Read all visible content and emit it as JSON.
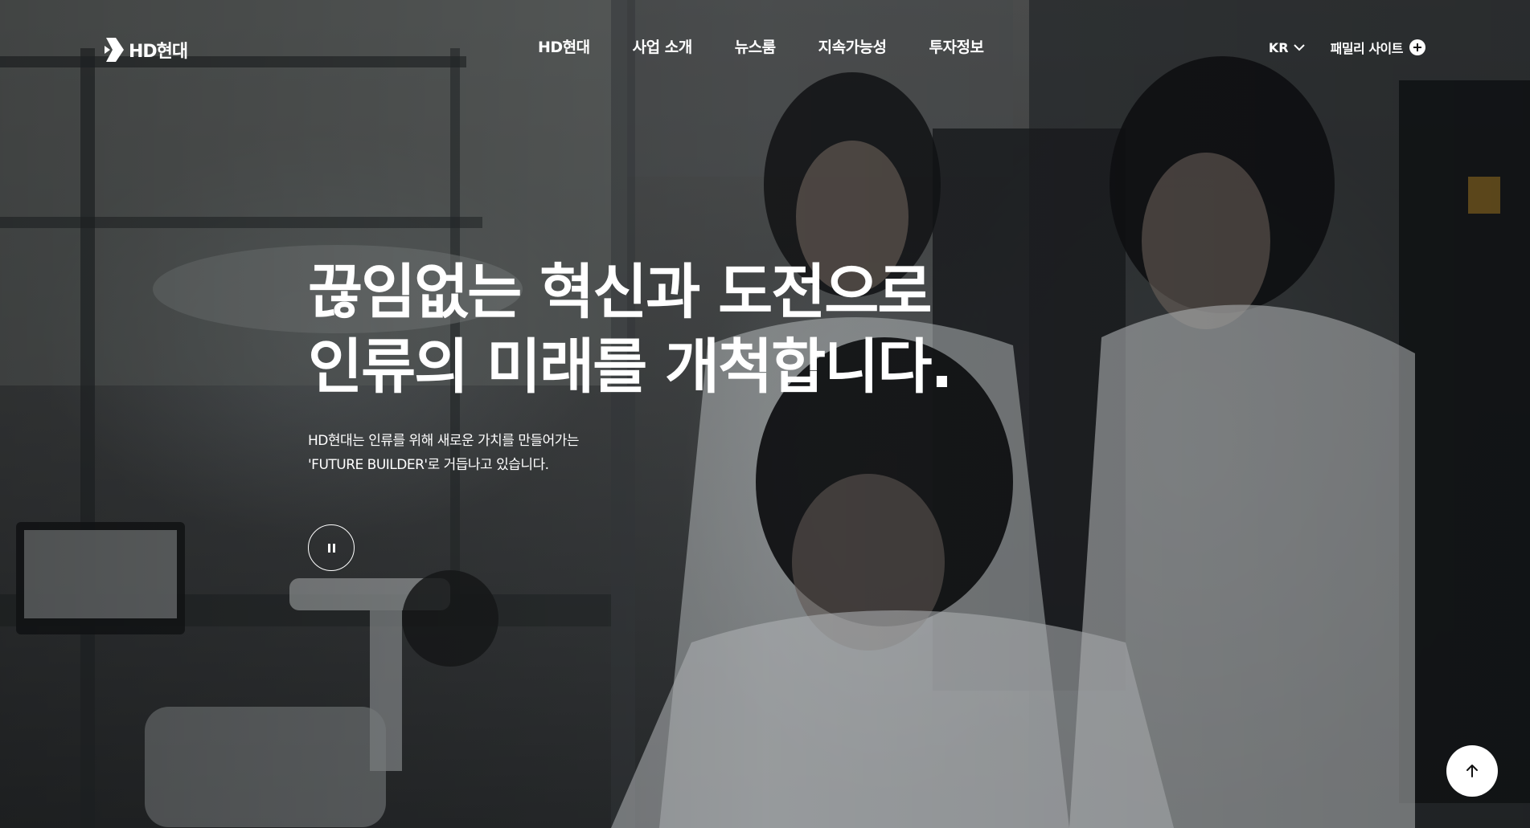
{
  "header": {
    "logo_text": "HD현대",
    "nav": [
      {
        "label": "HD현대"
      },
      {
        "label": "사업 소개"
      },
      {
        "label": "뉴스룸"
      },
      {
        "label": "지속가능성"
      },
      {
        "label": "투자정보"
      }
    ],
    "language": "KR",
    "family_site": "패밀리 사이트"
  },
  "hero": {
    "headline_line1": "끊임없는 혁신과 도전으로",
    "headline_line2": "인류의 미래를 개척합니다.",
    "subcopy_line1": "HD현대는 인류를 위해 새로운 가치를 만들어가는",
    "subcopy_line2": "'FUTURE BUILDER'로 거듭나고 있습니다.",
    "pause_icon": "pause-icon"
  },
  "scroll_top_icon": "arrow-up-icon",
  "colors": {
    "text": "#ffffff",
    "top_button_bg": "#ffffff",
    "top_button_icon": "#111111"
  }
}
